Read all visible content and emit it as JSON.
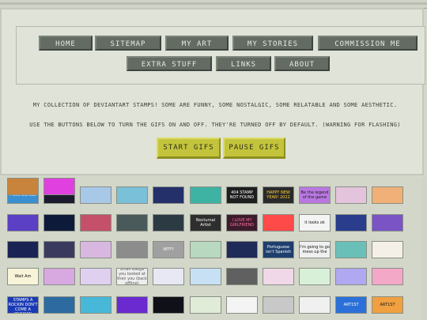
{
  "nav": {
    "row1": [
      "HOME",
      "SITEMAP",
      "MY ART",
      "MY STORIES",
      "COMMISSION ME"
    ],
    "row2": [
      "EXTRA STUFF",
      "LINKS",
      "ABOUT"
    ]
  },
  "intro": {
    "line1": "MY COLLECTION OF DEVIANTART STAMPS! SOME ARE FUNNY, SOME NOSTALGIC, SOME RELATABLE AND SOME AESTHETIC.",
    "line2": "USE THE BUTTONS BELOW TO TURN THE GIFS ON AND OFF. THEY'RE TURNED OFF BY DEFAULT. (WARNING FOR FLASHING)"
  },
  "gif_controls": {
    "start_label": "START GIFS",
    "pause_label": "PAUSE GIFS"
  },
  "stamps": [
    {
      "name": "computer-stamp",
      "bg": "#3a8fd0",
      "fg": "#ffffff",
      "text": "I love old ads"
    },
    {
      "name": "starfield-stamp",
      "bg": "#1b1b2e",
      "fg": "#ffffff",
      "text": ""
    },
    {
      "name": "pokemon-stamp",
      "bg": "#a8c8e8",
      "fg": "#000000",
      "text": ""
    },
    {
      "name": "sky-stamp",
      "bg": "#7ac0d8",
      "fg": "#000000",
      "text": ""
    },
    {
      "name": "space-stamp",
      "bg": "#24306a",
      "fg": "#ffffff",
      "text": ""
    },
    {
      "name": "teal-stamp",
      "bg": "#3fb3a3",
      "fg": "#000000",
      "text": ""
    },
    {
      "name": "404-stamp",
      "bg": "#1e1e1e",
      "fg": "#ffffff",
      "text": "404 STAMP NOT FOUND"
    },
    {
      "name": "happy-new-year-stamp",
      "bg": "#2a2a2a",
      "fg": "#ffd23a",
      "text": "HAPPY NEW YEAR! 2022"
    },
    {
      "name": "legend-stamp",
      "bg": "#b878e0",
      "fg": "#1c1c1c",
      "text": "Be the legend of the game"
    },
    {
      "name": "pastel-stamp",
      "bg": "#e4c4dc",
      "fg": "#000000",
      "text": ""
    },
    {
      "name": "orange-stamp",
      "bg": "#f0b078",
      "fg": "#000000",
      "text": ""
    },
    {
      "name": "vaporwave-stamp",
      "bg": "#5b3fc4",
      "fg": "#ffffff",
      "text": ""
    },
    {
      "name": "night-stamp",
      "bg": "#0e1a3a",
      "fg": "#ffffff",
      "text": ""
    },
    {
      "name": "sunset-stamp",
      "bg": "#c4506a",
      "fg": "#ffffff",
      "text": ""
    },
    {
      "name": "tv-stamp",
      "bg": "#4a5a5a",
      "fg": "#ffffff",
      "text": ""
    },
    {
      "name": "dark-tv-stamp",
      "bg": "#2c3a44",
      "fg": "#ffffff",
      "text": ""
    },
    {
      "name": "nocturnal-artist-stamp",
      "bg": "#2e2e2e",
      "fg": "#ffffff",
      "text": "Nocturnal Artist"
    },
    {
      "name": "girlfriend-stamp",
      "bg": "#3c1c2c",
      "fg": "#ff6ea0",
      "text": "I LOVE MY GIRLFRIEND"
    },
    {
      "name": "rainbow-stamp",
      "bg": "#ff4a4a",
      "fg": "#ffffff",
      "text": ""
    },
    {
      "name": "looks-ok-stamp",
      "bg": "#f4f4f4",
      "fg": "#111111",
      "text": "it looks ok"
    },
    {
      "name": "blue-text-stamp",
      "bg": "#2a3c8c",
      "fg": "#ffffff",
      "text": ""
    },
    {
      "name": "emoji-stamp",
      "bg": "#7a54c4",
      "fg": "#ffffff",
      "text": ""
    },
    {
      "name": "dark-blue-stamp",
      "bg": "#1a2454",
      "fg": "#ffffff",
      "text": ""
    },
    {
      "name": "galaxy-stamp",
      "bg": "#3a3a5e",
      "fg": "#ffffff",
      "text": ""
    },
    {
      "name": "pink-sky-stamp",
      "bg": "#d8b8e0",
      "fg": "#000000",
      "text": ""
    },
    {
      "name": "grey-stamp",
      "bg": "#8c8c8c",
      "fg": "#ffffff",
      "text": ""
    },
    {
      "name": "wtf-stamp",
      "bg": "#a0a0a0",
      "fg": "#ffffff",
      "text": "WTF?"
    },
    {
      "name": "map-stamp",
      "bg": "#b8d8c0",
      "fg": "#000000",
      "text": ""
    },
    {
      "name": "stars-stamp",
      "bg": "#1e2a58",
      "fg": "#ffffff",
      "text": ""
    },
    {
      "name": "portuguese-stamp",
      "bg": "#1e3e6e",
      "fg": "#ffffff",
      "text": "Portuguese isn't Spanish"
    },
    {
      "name": "bird-stamp",
      "bg": "#f0f0f0",
      "fg": "#111111",
      "text": "I'm going to go mess up the"
    },
    {
      "name": "creature-stamp",
      "bg": "#6ac0b8",
      "fg": "#000000",
      "text": ""
    },
    {
      "name": "hamster-stamp",
      "bg": "#f4f0e8",
      "fg": "#000000",
      "text": ""
    },
    {
      "name": "sun-stamp",
      "bg": "#f8f4d8",
      "fg": "#111111",
      "text": "Wait Am"
    },
    {
      "name": "moon-phase-stamp",
      "bg": "#d8a8e0",
      "fg": "#ffffff",
      "text": ""
    },
    {
      "name": "planet-stamp",
      "bg": "#e0d0f0",
      "fg": "#000000",
      "text": ""
    },
    {
      "name": "small-text-stamp",
      "bg": "#eeeeee",
      "fg": "#555555",
      "text": "Small badge you looked at then you (back offline)"
    },
    {
      "name": "light-stamp",
      "bg": "#e8e8f4",
      "fg": "#000000",
      "text": ""
    },
    {
      "name": "light-blue-stamp",
      "bg": "#c8e0f4",
      "fg": "#000000",
      "text": ""
    },
    {
      "name": "moon-stamp",
      "bg": "#606060",
      "fg": "#ffffff",
      "text": ""
    },
    {
      "name": "flowers-stamp",
      "bg": "#f0d8e8",
      "fg": "#000000",
      "text": ""
    },
    {
      "name": "mint-stamp",
      "bg": "#d8f0d8",
      "fg": "#000000",
      "text": ""
    },
    {
      "name": "lavender-stamp",
      "bg": "#b0a8f0",
      "fg": "#000000",
      "text": ""
    },
    {
      "name": "flag-stamp",
      "bg": "#f4a8c8",
      "fg": "#000000",
      "text": ""
    },
    {
      "name": "when-the-stamps-stamp",
      "bg": "#1a3ab4",
      "fg": "#ffffff",
      "text": "WHEN THE STAMPS A ROCKIN DON'T COME A KNOCKIN"
    },
    {
      "name": "ocean-stamp",
      "bg": "#2c6aa0",
      "fg": "#ffffff",
      "text": ""
    },
    {
      "name": "aqua-stamp",
      "bg": "#48b8d8",
      "fg": "#000000",
      "text": ""
    },
    {
      "name": "purple-stamp",
      "bg": "#6a2ad0",
      "fg": "#ffffff",
      "text": ""
    },
    {
      "name": "sparkle-stamp",
      "bg": "#101018",
      "fg": "#ffffff",
      "text": ""
    },
    {
      "name": "pale-stamp",
      "bg": "#e0ecd8",
      "fg": "#000000",
      "text": ""
    },
    {
      "name": "feather-stamp",
      "bg": "#f4f4f4",
      "fg": "#000000",
      "text": ""
    },
    {
      "name": "pattern-stamp",
      "bg": "#c8c8c8",
      "fg": "#000000",
      "text": ""
    },
    {
      "name": "license-plate-stamp",
      "bg": "#f0f0f0",
      "fg": "#222222",
      "text": ""
    },
    {
      "name": "artist-stamp",
      "bg": "#2a70d8",
      "fg": "#ffffff",
      "text": "ART1ST"
    },
    {
      "name": "artist-orange-stamp",
      "bg": "#f0a040",
      "fg": "#1a1a1a",
      "text": "ART1ST"
    },
    {
      "name": "burger-stamp",
      "bg": "#c8843c",
      "fg": "#000000",
      "text": ""
    },
    {
      "name": "pink-border-stamp",
      "bg": "#e040e0",
      "fg": "#000000",
      "text": ""
    }
  ]
}
